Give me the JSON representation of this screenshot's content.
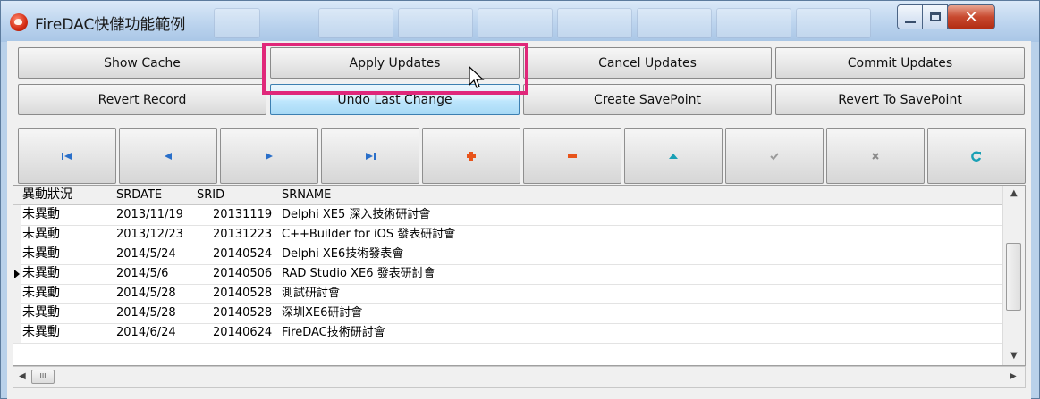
{
  "window": {
    "title": "FireDAC快儲功能範例"
  },
  "toolbar": {
    "row1": [
      "Show Cache",
      "Apply Updates",
      "Cancel Updates",
      "Commit Updates"
    ],
    "row2": [
      "Revert Record",
      "Undo Last Change",
      "Create SavePoint",
      "Revert To SavePoint"
    ]
  },
  "navigator": {
    "buttons": [
      {
        "name": "first-record",
        "icon": "first-record-icon",
        "color": "#2a6fc9"
      },
      {
        "name": "prior-record",
        "icon": "prior-record-icon",
        "color": "#2a6fc9"
      },
      {
        "name": "next-record",
        "icon": "next-record-icon",
        "color": "#2a6fc9"
      },
      {
        "name": "last-record",
        "icon": "last-record-icon",
        "color": "#2a6fc9"
      },
      {
        "name": "insert-record",
        "icon": "plus-icon",
        "color": "#e8541b"
      },
      {
        "name": "delete-record",
        "icon": "minus-icon",
        "color": "#e8541b"
      },
      {
        "name": "edit-record",
        "icon": "up-arrow-icon",
        "color": "#1aa0b5"
      },
      {
        "name": "post-edit",
        "icon": "check-icon",
        "color": "#9a9a9a"
      },
      {
        "name": "cancel-edit",
        "icon": "x-icon",
        "color": "#9a9a9a"
      },
      {
        "name": "refresh-data",
        "icon": "refresh-icon",
        "color": "#1aa0b5"
      }
    ]
  },
  "grid": {
    "columns": [
      "異動狀況",
      "SRDATE",
      "SRID",
      "SRNAME"
    ],
    "rows": [
      {
        "status": "未異動",
        "date": "2013/11/19",
        "id": "20131119",
        "name": "Delphi XE5 深入技術研討會",
        "current": false
      },
      {
        "status": "未異動",
        "date": "2013/12/23",
        "id": "20131223",
        "name": "C++Builder for iOS 發表研討會",
        "current": false
      },
      {
        "status": "未異動",
        "date": "2014/5/24",
        "id": "20140524",
        "name": "Delphi XE6技術發表會",
        "current": false
      },
      {
        "status": "未異動",
        "date": "2014/5/6",
        "id": "20140506",
        "name": "RAD Studio XE6 發表研討會",
        "current": true
      },
      {
        "status": "未異動",
        "date": "2014/5/28",
        "id": "20140528",
        "name": "測試研討會",
        "current": false
      },
      {
        "status": "未異動",
        "date": "2014/5/28",
        "id": "20140528",
        "name": "深圳XE6研討會",
        "current": false
      },
      {
        "status": "未異動",
        "date": "2014/6/24",
        "id": "20140624",
        "name": "FireDAC技術研討會",
        "current": false
      }
    ]
  },
  "colors": {
    "highlight": "#e0277a",
    "hot_button": "#bee6fd"
  }
}
